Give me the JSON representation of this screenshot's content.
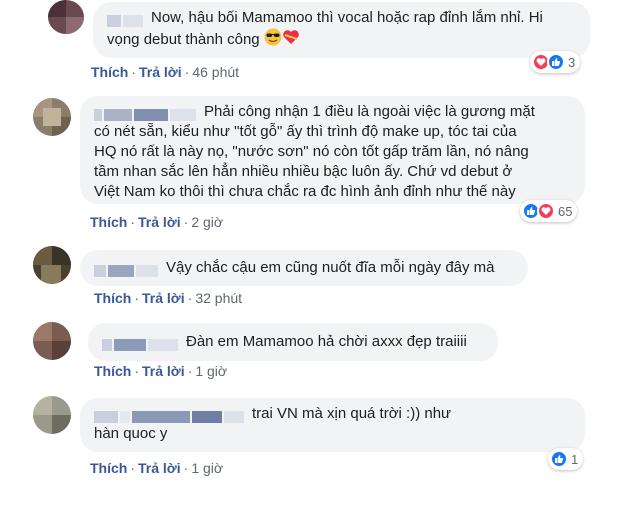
{
  "comments": [
    {
      "text_line1": "Now, hậu bối Mamamoo thì vocal hoặc rap đỉnh lắm nhỉ. Hi",
      "text_line2": "vọng debut thành công",
      "emojis": [
        "smiling-face-with-sunglasses",
        "heart-with-ribbon"
      ],
      "like_label": "Thích",
      "reply_label": "Trả lời",
      "time": "46 phút",
      "reactions": [
        "love",
        "like"
      ],
      "reaction_count": "3"
    },
    {
      "text": "Phải công nhận 1 điều là ngoài việc là gương mặt\ncó nét sẵn, kiểu như \"tốt gỗ\" ấy thì trình độ make up, tóc tai của\nHQ nó rất là này nọ, \"nước sơn\" nó còn tốt gấp trăm lần, nó nâng\ntầm nhan sắc lên hẳn nhiều nhiều bậc luôn ấy. Chứ vd debut ở\nViệt Nam ko thôi thì chưa chắc ra đc hình ảnh đỉnh như thế này",
      "like_label": "Thích",
      "reply_label": "Trả lời",
      "time": "2 giờ",
      "reactions": [
        "like",
        "love"
      ],
      "reaction_count": "65"
    },
    {
      "text": "Vậy chắc cậu em cũng nuốt đĩa mỗi ngày đây mà",
      "like_label": "Thích",
      "reply_label": "Trả lời",
      "time": "32 phút"
    },
    {
      "text": "Đàn em Mamamoo hả chời axxx đẹp traiiii",
      "like_label": "Thích",
      "reply_label": "Trả lời",
      "time": "1 giờ"
    },
    {
      "text_line1": "trai VN mà xịn quá trời :)) như",
      "text_line2": "hàn quoc y",
      "like_label": "Thích",
      "reply_label": "Trả lời",
      "time": "1 giờ",
      "reactions": [
        "like"
      ],
      "reaction_count": "1"
    }
  ],
  "colors": {
    "bubble": "#f2f3f5",
    "link": "#385898",
    "meta": "#606770",
    "like_blue": "#1877f2",
    "love_red": "#f33e58"
  }
}
